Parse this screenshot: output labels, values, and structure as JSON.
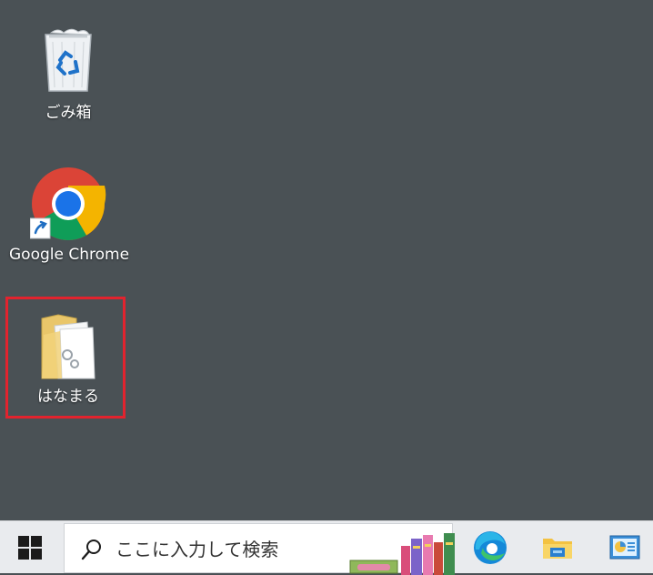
{
  "desktop": {
    "icons": [
      {
        "label": "ごみ箱",
        "icon": "recycle-bin-icon"
      },
      {
        "label": "Google Chrome",
        "icon": "chrome-icon"
      },
      {
        "label": "はなまる",
        "icon": "folder-icon"
      }
    ],
    "highlight_color": "#e2232e"
  },
  "taskbar": {
    "start_icon": "windows-start-icon",
    "search": {
      "placeholder": "ここに入力して検索",
      "icon": "search-icon",
      "decoration": "books-icon"
    },
    "apps": [
      {
        "icon": "edge-icon"
      },
      {
        "icon": "file-explorer-icon"
      },
      {
        "icon": "control-panel-icon"
      }
    ]
  },
  "colors": {
    "desktop_bg": "#4a5155",
    "taskbar_bg": "#e9ebee"
  }
}
